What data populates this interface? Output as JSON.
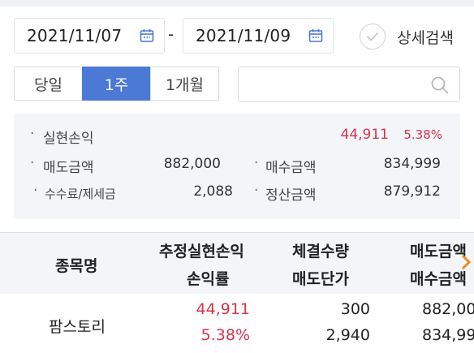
{
  "filter": {
    "date_from": "2021/11/07",
    "date_to": "2021/11/09",
    "separator": "-",
    "detail_search_label": "상세검색"
  },
  "tabs": [
    {
      "label": "당일",
      "active": false
    },
    {
      "label": "1주",
      "active": true
    },
    {
      "label": "1개월",
      "active": false
    }
  ],
  "search": {
    "placeholder": ""
  },
  "summary": {
    "realized_pl": {
      "label": "실현손익",
      "value": "44,911",
      "rate": "5.38%"
    },
    "sell_amount": {
      "label": "매도금액",
      "value": "882,000"
    },
    "buy_amount": {
      "label": "매수금액",
      "value": "834,999"
    },
    "fees": {
      "label": "수수료/제세금",
      "value": "2,088"
    },
    "settlement": {
      "label": "정산금액",
      "value": "879,912"
    }
  },
  "table": {
    "headers": {
      "name": "종목명",
      "est_pl": "추정실현손익",
      "pl_rate": "손익률",
      "exec_qty": "체결수량",
      "sell_price": "매도단가",
      "sell_amt": "매도금액",
      "buy_amt": "매수금액"
    },
    "rows": [
      {
        "name": "팜스토리",
        "est_pl": "44,911",
        "pl_rate": "5.38%",
        "exec_qty": "300",
        "sell_price": "2,940",
        "sell_amt": "882,00",
        "buy_amt": "834,99"
      }
    ]
  },
  "colors": {
    "accent": "#4a79d6",
    "loss_profit_red": "#d6344a",
    "panel_bg": "#f3f5f9",
    "scroll_hint": "#f08a24"
  },
  "icons": {
    "calendar": "calendar-icon",
    "check": "check-circle-icon",
    "search": "search-icon",
    "more": "chevron-right-icon"
  }
}
